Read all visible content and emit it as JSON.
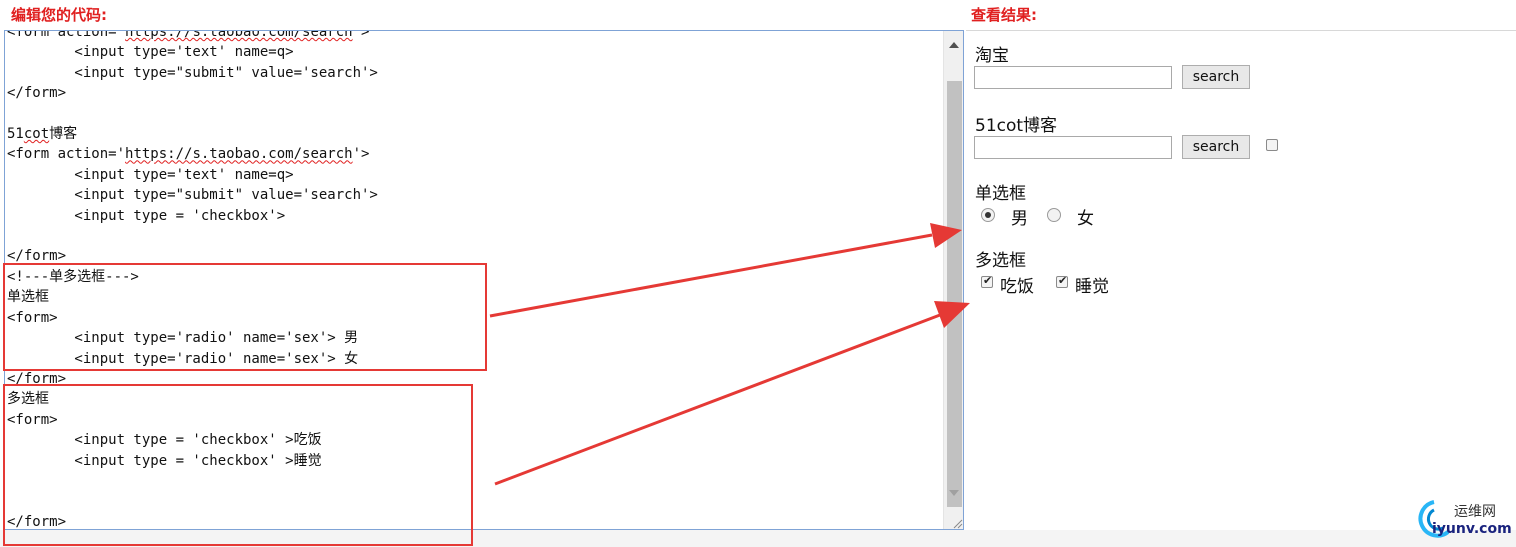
{
  "editor": {
    "heading": "编辑您的代码:",
    "lines": [
      "<form action='https://s.taobao.com/search'>",
      "        <input type='text' name=q>",
      "        <input type=\"submit\" value='search'>",
      "</form>",
      "",
      "51cot博客",
      "<form action='https://s.taobao.com/search'>",
      "        <input type='text' name=q>",
      "        <input type=\"submit\" value='search'>",
      "        <input type = 'checkbox'>",
      "",
      "</form>",
      "<!---单多选框--->",
      "单选框",
      "<form>",
      "        <input type='radio' name='sex'> 男",
      "        <input type='radio' name='sex'> 女",
      "</form>",
      "多选框",
      "<form>",
      "        <input type = 'checkbox' >吃饭",
      "        <input type = 'checkbox' >睡觉",
      "",
      "",
      "</form>"
    ]
  },
  "result": {
    "heading": "查看结果:",
    "section1": {
      "label": "淘宝",
      "button": "search"
    },
    "section2": {
      "label": "51cot博客",
      "button": "search",
      "checkbox_checked": false
    },
    "radio_section": {
      "label": "单选框",
      "options": [
        {
          "label": "男",
          "checked": true
        },
        {
          "label": "女",
          "checked": false
        }
      ]
    },
    "checkbox_section": {
      "label": "多选框",
      "options": [
        {
          "label": "吃饭",
          "checked": true
        },
        {
          "label": "睡觉",
          "checked": true
        }
      ]
    }
  },
  "watermark": {
    "line1": "运维网",
    "line2": "iyunv.com"
  },
  "colors": {
    "heading": "#e02020",
    "annotation": "#e53935",
    "editor_border": "#7fa3d6"
  },
  "icons": [
    "scroll-up-arrow-icon",
    "scroll-down-arrow-icon",
    "resize-grip-icon",
    "annotation-arrow-icon",
    "watermark-logo-icon"
  ]
}
